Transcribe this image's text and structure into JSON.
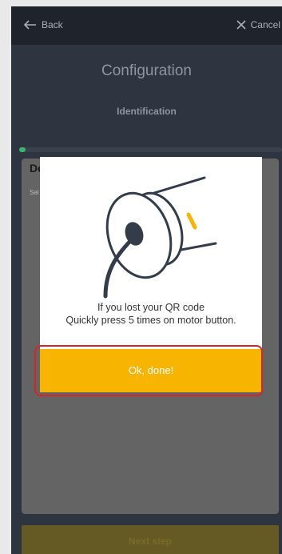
{
  "header": {
    "back_label": "Back",
    "cancel_label": "Cancel"
  },
  "page": {
    "title": "Configuration",
    "subtitle": "Identification"
  },
  "progress": {
    "fraction": 0.02
  },
  "card": {
    "heading": "De",
    "hint": "Sel"
  },
  "modal": {
    "message_line1": "If you lost your QR code",
    "message_line2": "Quickly press 5 times on motor button.",
    "button_label": "Ok, done!"
  },
  "footer": {
    "next_label": "Next step"
  },
  "colors": {
    "accent": "#f7b400",
    "progress": "#3db46d",
    "highlight": "#d8232a"
  }
}
